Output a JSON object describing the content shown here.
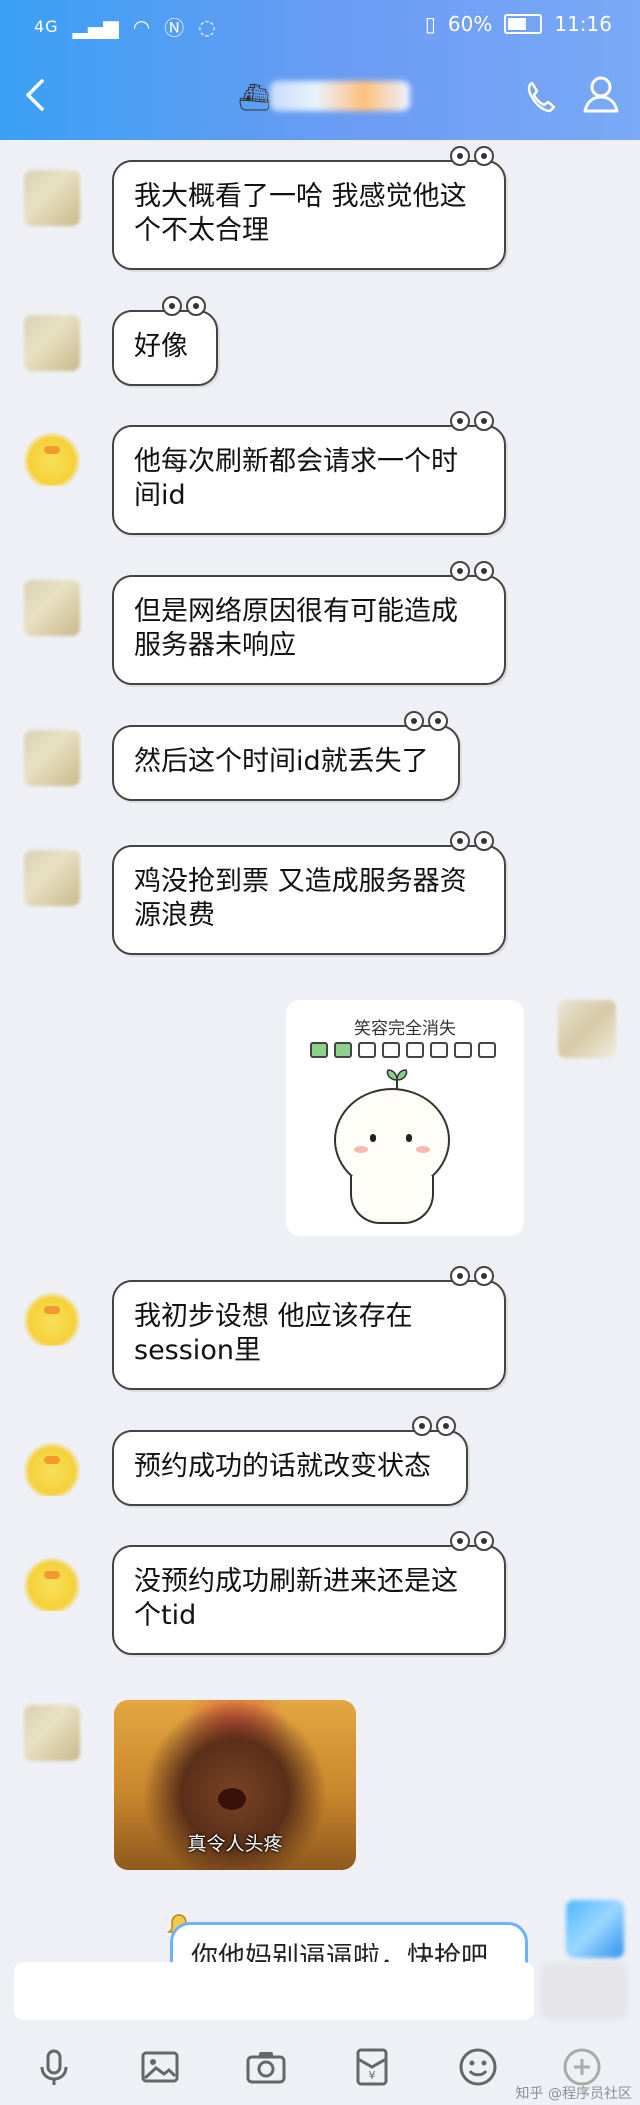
{
  "status_bar": {
    "network": "4G",
    "battery_percent": "60%",
    "time": "11:16"
  },
  "header": {
    "title": "",
    "icons": [
      "back-icon",
      "ship-icon",
      "call-icon",
      "profile-icon"
    ]
  },
  "messages": [
    {
      "side": "left",
      "text_line1": "我大概看了一哈 我感觉他这",
      "text_line2": "个不太合理"
    },
    {
      "side": "left",
      "text_line1": "好像",
      "text_line2": ""
    },
    {
      "side": "left",
      "text_line1": "他每次刷新都会请求一个时",
      "text_line2": "间id"
    },
    {
      "side": "left",
      "text_line1": "但是网络原因很有可能造成",
      "text_line2": "服务器未响应"
    },
    {
      "side": "left",
      "text_line1": "然后这个时间id就丢失了",
      "text_line2": ""
    },
    {
      "side": "left",
      "text_line1": "鸡没抢到票 又造成服务器资",
      "text_line2": "源浪费"
    },
    {
      "side": "left",
      "text_line1": "我初步设想 他应该存在",
      "text_line2": "session里"
    },
    {
      "side": "left",
      "text_line1": "预约成功的话就改变状态",
      "text_line2": ""
    },
    {
      "side": "left",
      "text_line1": "没预约成功刷新进来还是这",
      "text_line2": "个tid"
    }
  ],
  "sticker": {
    "caption": "笑容完全消失"
  },
  "meme": {
    "caption": "真令人头疼"
  },
  "outgoing_partial": {
    "text": "你他妈别逼逼啦，快抢吧"
  },
  "toolbar": {
    "icons": [
      "microphone-icon",
      "image-icon",
      "camera-icon",
      "red-packet-icon",
      "emoji-icon",
      "more-icon"
    ]
  },
  "watermark": "知乎 @程序员社区"
}
